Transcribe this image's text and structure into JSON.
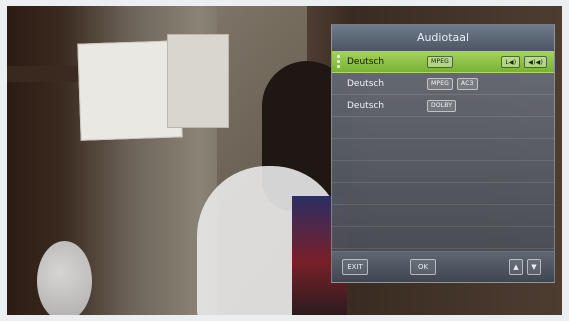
{
  "osd": {
    "title": "Audiotaal",
    "items": [
      {
        "label": "Deutsch",
        "tags": [
          "MPEG"
        ],
        "right_tags": [
          "L◀)",
          "◀)◀)"
        ]
      },
      {
        "label": "Deutsch",
        "tags": [
          "MPEG",
          "AC3"
        ],
        "right_tags": []
      },
      {
        "label": "Deutsch",
        "tags": [
          "DOLBY"
        ],
        "right_tags": []
      }
    ],
    "footer": {
      "exit": "EXIT",
      "ok": "OK",
      "up": "▲",
      "down": "▼"
    }
  },
  "colors": {
    "highlight": "#a7d35b",
    "panel": "#5b626d"
  }
}
